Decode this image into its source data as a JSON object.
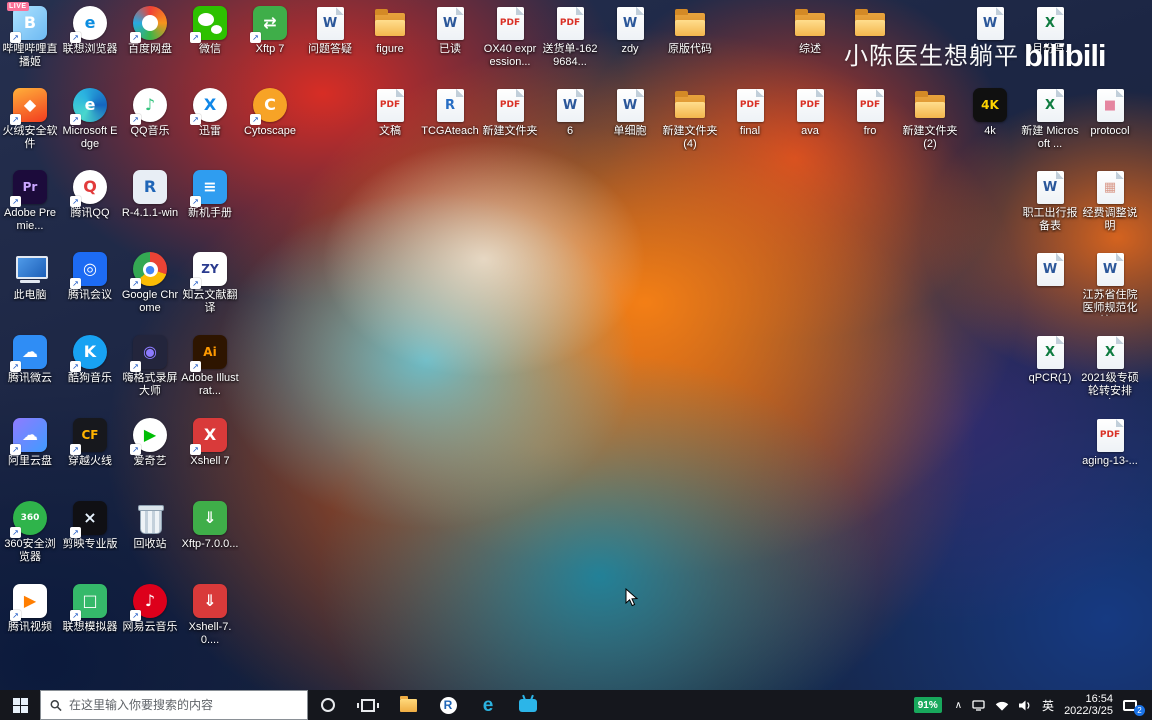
{
  "watermark": {
    "author": "小陈医生想躺平",
    "logo": "bilibili"
  },
  "desktop": {
    "shortcut_arrow": "↗",
    "icons": [
      {
        "n": "bilibili-livehime",
        "c": 0,
        "r": 0,
        "l": "哔哩哔哩直播姬",
        "k": "tile",
        "g": "B",
        "bg": "linear-gradient(135deg,#aee3ff,#6db9f2)",
        "fg": "#ffffff",
        "badge": "LIVE",
        "sc": 1
      },
      {
        "n": "lenovo-browser",
        "c": 1,
        "r": 0,
        "l": "联想浏览器",
        "k": "circle",
        "g": "e",
        "bg": "#ffffff",
        "fg": "#0b8de0",
        "sc": 1
      },
      {
        "n": "baidu-netdisk",
        "c": 2,
        "r": 0,
        "l": "百度网盘",
        "k": "circle",
        "g": "",
        "bg": "conic-gradient(#ef4136,#f7941d,#39b54a,#27aae1,#ef4136)",
        "cls": "ring",
        "sc": 1
      },
      {
        "n": "wechat",
        "c": 3,
        "r": 0,
        "l": "微信",
        "k": "tile",
        "g": "",
        "bg": "#2dc100",
        "cls": "wechat",
        "sc": 1
      },
      {
        "n": "xftp-7",
        "c": 4,
        "r": 0,
        "l": "Xftp 7",
        "k": "tile",
        "g": "⇄",
        "bg": "#3fae49",
        "fg": "#ffffff",
        "sc": 1
      },
      {
        "n": "word-doc",
        "c": 5,
        "r": 0,
        "l": "问题答疑",
        "k": "page",
        "g": "W",
        "fg": "#2b579a"
      },
      {
        "n": "folder",
        "c": 6,
        "r": 0,
        "l": "figure",
        "k": "folder"
      },
      {
        "n": "word-doc",
        "c": 7,
        "r": 0,
        "l": "已读",
        "k": "page",
        "g": "W",
        "fg": "#2b579a"
      },
      {
        "n": "pdf-doc",
        "c": 8,
        "r": 0,
        "l": "OX40 expression...",
        "k": "page",
        "g": "PDF",
        "fg": "#d93025"
      },
      {
        "n": "pdf-doc",
        "c": 9,
        "r": 0,
        "l": "送货单-1629684...",
        "k": "page",
        "g": "PDF",
        "fg": "#d93025"
      },
      {
        "n": "word-doc",
        "c": 10,
        "r": 0,
        "l": "zdy",
        "k": "page",
        "g": "W",
        "fg": "#2b579a"
      },
      {
        "n": "folder",
        "c": 11,
        "r": 0,
        "l": "原版代码",
        "k": "folder"
      },
      {
        "n": "folder",
        "c": 13,
        "r": 0,
        "l": "综述",
        "k": "folder"
      },
      {
        "n": "folder",
        "c": 14,
        "r": 0,
        "l": "",
        "k": "folder"
      },
      {
        "n": "word-doc",
        "c": 16,
        "r": 0,
        "l": "",
        "k": "page",
        "g": "W",
        "fg": "#2b579a"
      },
      {
        "n": "excel-doc",
        "c": 17,
        "r": 0,
        "l": "9月份写...",
        "k": "page",
        "g": "X",
        "fg": "#107c41"
      },
      {
        "n": "huorong-security",
        "c": 0,
        "r": 1,
        "l": "火绒安全软件",
        "k": "tile",
        "g": "◆",
        "bg": "linear-gradient(160deg,#ffb03a,#f23c1f)",
        "fg": "#ffffff",
        "sc": 1
      },
      {
        "n": "microsoft-edge",
        "c": 1,
        "r": 1,
        "l": "Microsoft Edge",
        "k": "circle",
        "g": "e",
        "bg": "conic-gradient(from 210deg,#49d7cd,#2bb3e0,#1565c0,#49d7cd)",
        "fg": "#ffffff",
        "sc": 1
      },
      {
        "n": "qq-music",
        "c": 2,
        "r": 1,
        "l": "QQ音乐",
        "k": "circle",
        "g": "♪",
        "bg": "#ffffff",
        "fg": "#31c27c",
        "sc": 1
      },
      {
        "n": "thunder",
        "c": 3,
        "r": 1,
        "l": "迅雷",
        "k": "circle",
        "g": "X",
        "bg": "#ffffff",
        "fg": "#1087e8",
        "sc": 1
      },
      {
        "n": "cytoscape",
        "c": 4,
        "r": 1,
        "l": "Cytoscape",
        "k": "circle",
        "g": "C",
        "bg": "#f7a326",
        "fg": "#ffffff",
        "sc": 1
      },
      {
        "n": "pdf-doc",
        "c": 6,
        "r": 1,
        "l": "文稿",
        "k": "page",
        "g": "PDF",
        "fg": "#d93025"
      },
      {
        "n": "r-doc",
        "c": 7,
        "r": 1,
        "l": "TCGAteach",
        "k": "page",
        "g": "R",
        "fg": "#276dc3"
      },
      {
        "n": "pdf-doc",
        "c": 8,
        "r": 1,
        "l": "新建文件夹",
        "k": "page",
        "g": "PDF",
        "fg": "#d93025"
      },
      {
        "n": "word-doc",
        "c": 9,
        "r": 1,
        "l": "6",
        "k": "page",
        "g": "W",
        "fg": "#2b579a"
      },
      {
        "n": "word-doc",
        "c": 10,
        "r": 1,
        "l": "单细胞",
        "k": "page",
        "g": "W",
        "fg": "#2b579a"
      },
      {
        "n": "folder",
        "c": 11,
        "r": 1,
        "l": "新建文件夹(4)",
        "k": "folder"
      },
      {
        "n": "pdf-doc",
        "c": 12,
        "r": 1,
        "l": "final",
        "k": "page",
        "g": "PDF",
        "fg": "#d93025"
      },
      {
        "n": "pdf-doc",
        "c": 13,
        "r": 1,
        "l": "ava",
        "k": "page",
        "g": "PDF",
        "fg": "#d93025"
      },
      {
        "n": "pdf-doc",
        "c": 14,
        "r": 1,
        "l": "fro",
        "k": "page",
        "g": "PDF",
        "fg": "#d93025"
      },
      {
        "n": "folder",
        "c": 15,
        "r": 1,
        "l": "新建文件夹(2)",
        "k": "folder"
      },
      {
        "n": "4k-downloader",
        "c": 16,
        "r": 1,
        "l": "4k",
        "k": "tile",
        "g": "4K",
        "bg": "#101010",
        "fg": "#ffd400"
      },
      {
        "n": "excel-doc",
        "c": 17,
        "r": 1,
        "l": "新建 Microsoft ...",
        "k": "page",
        "g": "X",
        "fg": "#107c41"
      },
      {
        "n": "image-doc",
        "c": 18,
        "r": 1,
        "l": "protocol",
        "k": "page",
        "g": "■",
        "fg": "#e585a0"
      },
      {
        "n": "adobe-premiere",
        "c": 0,
        "r": 2,
        "l": "Adobe Premie...",
        "k": "tile",
        "g": "Pr",
        "bg": "#1c0b3b",
        "fg": "#cba6ff",
        "sc": 1
      },
      {
        "n": "tencent-qq",
        "c": 1,
        "r": 2,
        "l": "腾讯QQ",
        "k": "circle",
        "g": "Q",
        "bg": "#ffffff",
        "fg": "#e23b3b",
        "sc": 1
      },
      {
        "n": "r-installer",
        "c": 2,
        "r": 2,
        "l": "R-4.1.1-win",
        "k": "tile",
        "g": "R",
        "bg": "#e8eef5",
        "fg": "#1f65b7"
      },
      {
        "n": "manual",
        "c": 3,
        "r": 2,
        "l": "新机手册",
        "k": "tile",
        "g": "≡",
        "bg": "#2f9df0",
        "fg": "#ffffff",
        "sc": 1
      },
      {
        "n": "word-doc",
        "c": 17,
        "r": 2,
        "l": "职工出行报备表",
        "k": "page",
        "g": "W",
        "fg": "#2b579a"
      },
      {
        "n": "image-doc",
        "c": 18,
        "r": 2,
        "l": "经费调整说明",
        "k": "page",
        "g": "▦",
        "fg": "#d99a8a"
      },
      {
        "n": "this-pc",
        "c": 0,
        "r": 3,
        "l": "此电脑",
        "k": "pc"
      },
      {
        "n": "tencent-meeting",
        "c": 1,
        "r": 3,
        "l": "腾讯会议",
        "k": "tile",
        "g": "◎",
        "bg": "#1d6bf3",
        "fg": "#ffffff",
        "sc": 1
      },
      {
        "n": "google-chrome",
        "c": 2,
        "r": 3,
        "l": "Google Chrome",
        "k": "circle",
        "g": "●",
        "bg": "conic-gradient(#ea4335 0 30%,#fbbc05 30% 63%,#34a853 63% 100%)",
        "fg": "#4285f4",
        "cls": "chrome",
        "sc": 1
      },
      {
        "n": "zhiyun-translate",
        "c": 3,
        "r": 3,
        "l": "知云文献翻译",
        "k": "tile",
        "g": "ZY",
        "bg": "#ffffff",
        "fg": "#2a3b8f",
        "sc": 1
      },
      {
        "n": "word-doc",
        "c": 17,
        "r": 3,
        "l": "",
        "k": "page",
        "g": "W",
        "fg": "#2b579a"
      },
      {
        "n": "word-doc",
        "c": 18,
        "r": 3,
        "l": "江苏省住院医师规范化培...",
        "k": "page",
        "g": "W",
        "fg": "#2b579a"
      },
      {
        "n": "tencent-weiyun",
        "c": 0,
        "r": 4,
        "l": "腾讯微云",
        "k": "tile",
        "g": "☁",
        "bg": "#2f8df5",
        "fg": "#ffffff",
        "sc": 1
      },
      {
        "n": "kugou-music",
        "c": 1,
        "r": 4,
        "l": "酷狗音乐",
        "k": "circle",
        "g": "K",
        "bg": "#18a2f2",
        "fg": "#ffffff",
        "sc": 1
      },
      {
        "n": "higeshi-recorder",
        "c": 2,
        "r": 4,
        "l": "嗨格式录屏大师",
        "k": "tile",
        "g": "◉",
        "bg": "#23253c",
        "fg": "#8d7bff",
        "sc": 1
      },
      {
        "n": "adobe-illustrator",
        "c": 3,
        "r": 4,
        "l": "Adobe Illustrat...",
        "k": "tile",
        "g": "Ai",
        "bg": "#2e1500",
        "fg": "#ff9a00",
        "sc": 1
      },
      {
        "n": "excel-doc",
        "c": 17,
        "r": 4,
        "l": "qPCR(1)",
        "k": "page",
        "g": "X",
        "fg": "#107c41"
      },
      {
        "n": "excel-doc",
        "c": 18,
        "r": 4,
        "l": "2021级专硕轮转安排（...",
        "k": "page",
        "g": "X",
        "fg": "#107c41"
      },
      {
        "n": "aliyun-drive",
        "c": 0,
        "r": 5,
        "l": "阿里云盘",
        "k": "tile",
        "g": "☁",
        "bg": "linear-gradient(135deg,#8f7bff,#3f9bff)",
        "fg": "#ffffff",
        "sc": 1
      },
      {
        "n": "crossfire",
        "c": 1,
        "r": 5,
        "l": "穿越火线",
        "k": "tile",
        "g": "CF",
        "bg": "#17181d",
        "fg": "#ffb300",
        "sc": 1
      },
      {
        "n": "iqiyi",
        "c": 2,
        "r": 5,
        "l": "爱奇艺",
        "k": "circle",
        "g": "▶",
        "bg": "#ffffff",
        "fg": "#00be06",
        "sc": 1
      },
      {
        "n": "xshell-7",
        "c": 3,
        "r": 5,
        "l": "Xshell 7",
        "k": "tile",
        "g": "X",
        "bg": "#d93a3a",
        "fg": "#ffffff",
        "sc": 1
      },
      {
        "n": "pdf-doc",
        "c": 18,
        "r": 5,
        "l": "aging-13-...",
        "k": "page",
        "g": "PDF",
        "fg": "#d93025"
      },
      {
        "n": "360-browser",
        "c": 0,
        "r": 6,
        "l": "360安全浏览器",
        "k": "circle",
        "g": "360",
        "bg": "#2fb44b",
        "fg": "#ffffff",
        "sc": 1
      },
      {
        "n": "jianying",
        "c": 1,
        "r": 6,
        "l": "剪映专业版",
        "k": "tile",
        "g": "×",
        "bg": "#101014",
        "fg": "#e8f4ff",
        "sc": 1
      },
      {
        "n": "recycle-bin",
        "c": 2,
        "r": 6,
        "l": "回收站",
        "k": "bin"
      },
      {
        "n": "xftp-installer",
        "c": 3,
        "r": 6,
        "l": "Xftp-7.0.0...",
        "k": "tile",
        "g": "⇓",
        "bg": "#3fae49",
        "fg": "#ffffff"
      },
      {
        "n": "tencent-video",
        "c": 0,
        "r": 7,
        "l": "腾讯视频",
        "k": "tile",
        "g": "▶",
        "bg": "#ffffff",
        "fg": "#ff7e00",
        "sc": 1
      },
      {
        "n": "lenovo-emulator",
        "c": 1,
        "r": 7,
        "l": "联想模拟器",
        "k": "tile",
        "g": "□",
        "bg": "#35b96a",
        "fg": "#ffffff",
        "sc": 1
      },
      {
        "n": "netease-music",
        "c": 2,
        "r": 7,
        "l": "网易云音乐",
        "k": "circle",
        "g": "♪",
        "bg": "#dd001b",
        "fg": "#ffffff",
        "sc": 1
      },
      {
        "n": "xshell-installer",
        "c": 3,
        "r": 7,
        "l": "Xshell-7.0....",
        "k": "tile",
        "g": "⇓",
        "bg": "#d93a3a",
        "fg": "#ffffff"
      }
    ]
  },
  "taskbar": {
    "search_placeholder": "在这里输入你要搜索的内容",
    "tray": {
      "battery": "91%",
      "chevron": "∧",
      "lang": "英",
      "time": "16:54",
      "date": "2022/3/25",
      "notification_count": "2"
    }
  }
}
